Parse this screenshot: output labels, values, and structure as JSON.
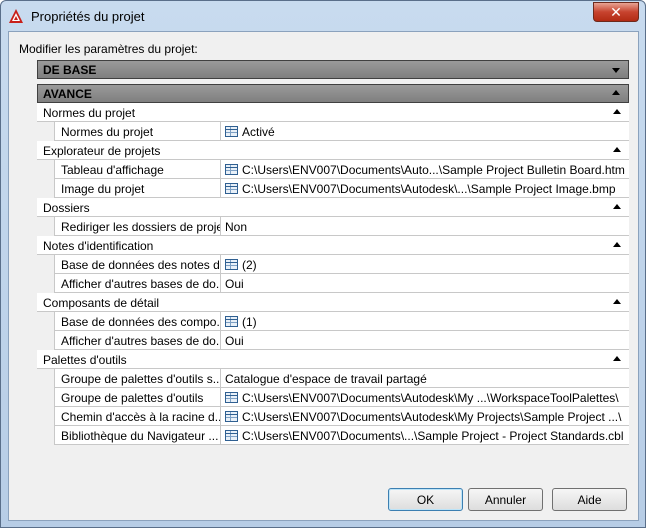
{
  "window": {
    "title": "Propriétés du projet",
    "close_glyph": "✕"
  },
  "prompt": "Modifier les paramètres du projet:",
  "sections": {
    "basic": {
      "label": "DE BASE",
      "state": "collapsed"
    },
    "advanced": {
      "label": "AVANCE",
      "state": "expanded"
    }
  },
  "categories": [
    {
      "label": "Normes du projet",
      "props": [
        {
          "name": "Normes du projet",
          "value": "Activé",
          "icon": "table-icon"
        }
      ]
    },
    {
      "label": "Explorateur de projets",
      "props": [
        {
          "name": "Tableau d'affichage",
          "value": "C:\\Users\\ENV007\\Documents\\Auto...\\Sample Project Bulletin Board.htm",
          "icon": "table-icon"
        },
        {
          "name": "Image du projet",
          "value": "C:\\Users\\ENV007\\Documents\\Autodesk\\...\\Sample Project Image.bmp",
          "icon": "table-icon"
        }
      ]
    },
    {
      "label": "Dossiers",
      "props": [
        {
          "name": "Rediriger les dossiers de projet",
          "value": "Non",
          "icon": ""
        }
      ]
    },
    {
      "label": "Notes d'identification",
      "props": [
        {
          "name": "Base de données des notes d'...",
          "value": "(2)",
          "icon": "table-icon"
        },
        {
          "name": "Afficher d'autres bases de do...",
          "value": "Oui",
          "icon": ""
        }
      ]
    },
    {
      "label": "Composants de détail",
      "props": [
        {
          "name": "Base de données des compo...",
          "value": "(1)",
          "icon": "table-icon"
        },
        {
          "name": "Afficher d'autres bases de do...",
          "value": "Oui",
          "icon": ""
        }
      ]
    },
    {
      "label": "Palettes d'outils",
      "props": [
        {
          "name": "Groupe de palettes d'outils s...",
          "value": "Catalogue d'espace de travail partagé",
          "icon": ""
        },
        {
          "name": "Groupe de palettes d'outils",
          "value": "C:\\Users\\ENV007\\Documents\\Autodesk\\My ...\\WorkspaceToolPalettes\\",
          "icon": "table-icon"
        },
        {
          "name": "Chemin d'accès à la racine d...",
          "value": "C:\\Users\\ENV007\\Documents\\Autodesk\\My Projects\\Sample Project ...\\",
          "icon": "table-icon"
        },
        {
          "name": "Bibliothèque du Navigateur ...",
          "value": "C:\\Users\\ENV007\\Documents\\...\\Sample Project - Project Standards.cbl",
          "icon": "table-icon"
        }
      ]
    }
  ],
  "buttons": {
    "ok": "OK",
    "cancel": "Annuler",
    "help": "Aide"
  },
  "colors": {
    "app_icon_red": "#c8201a",
    "section_header": "#8c8c8c"
  }
}
